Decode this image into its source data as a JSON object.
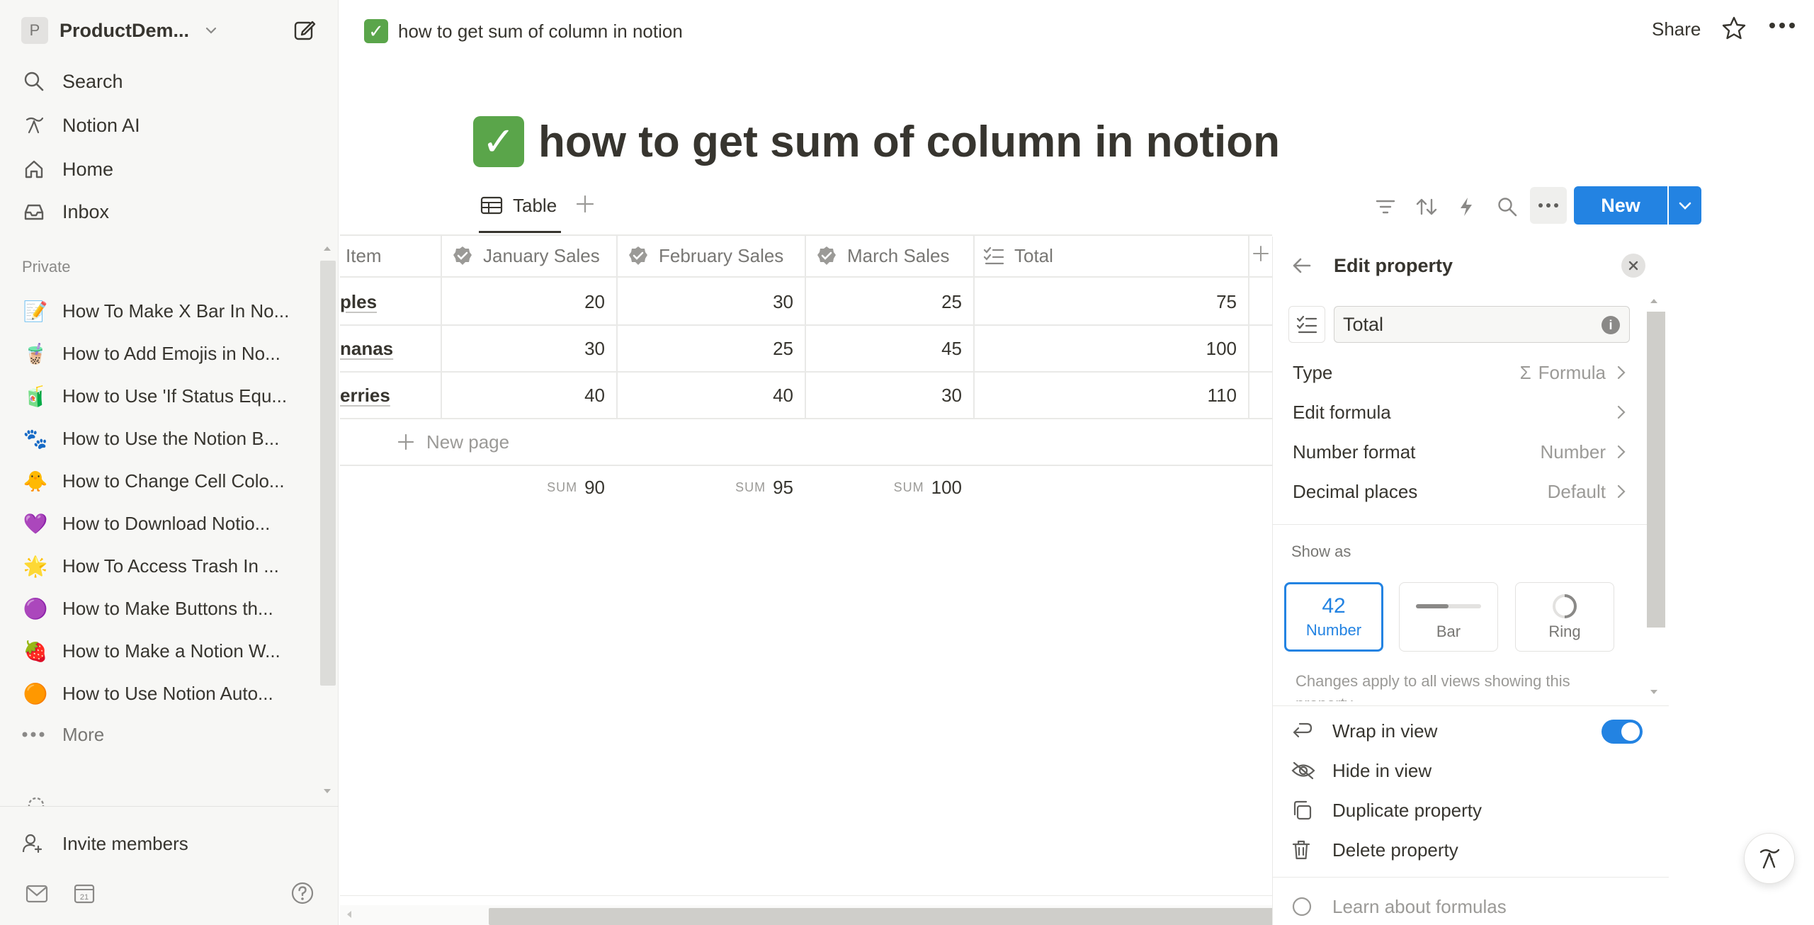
{
  "sidebar": {
    "workspace": {
      "initial": "P",
      "name": "ProductDem..."
    },
    "nav": [
      {
        "label": "Search",
        "icon": "search-icon"
      },
      {
        "label": "Notion AI",
        "icon": "notion-ai-icon"
      },
      {
        "label": "Home",
        "icon": "home-icon"
      },
      {
        "label": "Inbox",
        "icon": "inbox-icon"
      }
    ],
    "section_label": "Private",
    "pages": [
      {
        "emoji": "📝",
        "label": "How To Make X Bar In No..."
      },
      {
        "emoji": "🧋",
        "label": "How to Add Emojis in No..."
      },
      {
        "emoji": "🧃",
        "label": "How to Use 'If Status Equ..."
      },
      {
        "emoji": "🐾",
        "label": "How to Use the Notion B..."
      },
      {
        "emoji": "🐥",
        "label": "How to Change Cell Colo..."
      },
      {
        "emoji": "💜",
        "label": "How to Download Notio..."
      },
      {
        "emoji": "🌟",
        "label": "How To Access Trash In ..."
      },
      {
        "emoji": "🟣",
        "label": "How to Make Buttons th..."
      },
      {
        "emoji": "🍓",
        "label": "How to Make a Notion W..."
      },
      {
        "emoji": "🟠",
        "label": "How to Use Notion Auto..."
      }
    ],
    "more_label": "More",
    "invite_label": "Invite members",
    "calendar_day": "21"
  },
  "topbar": {
    "title": "how to get sum of column in notion",
    "share_label": "Share"
  },
  "page": {
    "title": "how to get sum of column in notion",
    "check_glyph": "✓"
  },
  "view": {
    "tab_label": "Table",
    "new_label": "New"
  },
  "table": {
    "headers": [
      "Item",
      "January Sales",
      "February Sales",
      "March Sales",
      "Total"
    ],
    "rows": [
      {
        "item": "ples",
        "jan": "20",
        "feb": "30",
        "mar": "25",
        "total": "75"
      },
      {
        "item": "nanas",
        "jan": "30",
        "feb": "25",
        "mar": "45",
        "total": "100"
      },
      {
        "item": "erries",
        "jan": "40",
        "feb": "40",
        "mar": "30",
        "total": "110"
      }
    ],
    "new_page_label": "New page",
    "sum_label": "SUM",
    "sums": {
      "jan": "90",
      "feb": "95",
      "mar": "100"
    }
  },
  "panel": {
    "title": "Edit property",
    "name_value": "Total",
    "info_glyph": "i",
    "rows": [
      {
        "label": "Type",
        "value": "Formula",
        "value_prefix": "Σ"
      },
      {
        "label": "Edit formula",
        "value": ""
      },
      {
        "label": "Number format",
        "value": "Number"
      },
      {
        "label": "Decimal places",
        "value": "Default"
      }
    ],
    "show_as_label": "Show as",
    "show_as": [
      {
        "big": "42",
        "label": "Number",
        "selected": true
      },
      {
        "big": "",
        "label": "Bar",
        "selected": false
      },
      {
        "big": "",
        "label": "Ring",
        "selected": false
      }
    ],
    "note": "Changes apply to all views showing this property",
    "actions": [
      {
        "label": "Wrap in view",
        "icon": "wrap-icon"
      },
      {
        "label": "Hide in view",
        "icon": "eye-off-icon"
      },
      {
        "label": "Duplicate property",
        "icon": "duplicate-icon"
      },
      {
        "label": "Delete property",
        "icon": "trash-icon"
      }
    ],
    "wrap_enabled": true,
    "learn_label": "Learn about formulas"
  },
  "colors": {
    "accent": "#2383e2",
    "check_green": "#5aa54a",
    "sidebar_bg": "#f7f7f5",
    "text": "#37352f",
    "muted": "#9b9a97"
  }
}
